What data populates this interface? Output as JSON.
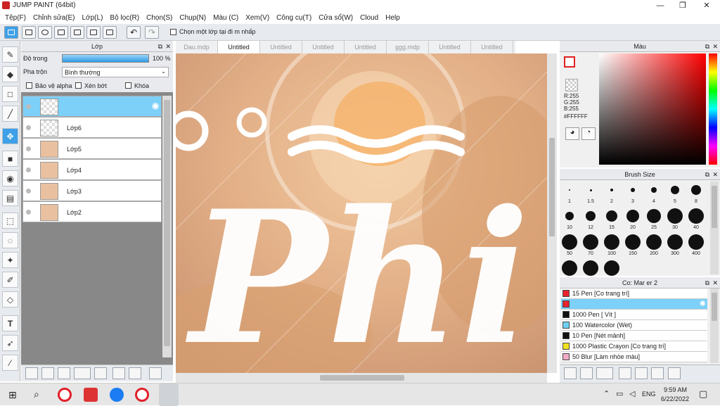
{
  "app": {
    "title": "JUMP PAINT (64bit)"
  },
  "menu": [
    "Tệp(F)",
    "Chỉnh sửa(E)",
    "Lớp(L)",
    "Bộ lọc(R)",
    "Chọn(S)",
    "Chụp(N)",
    "Màu (C)",
    "Xem(V)",
    "Công cụ(T)",
    "Cửa sổ(W)",
    "Cloud",
    "Help"
  ],
  "toolbar": {
    "option_label": "Chọn một lớp tại đi m nhấp"
  },
  "layers": {
    "title": "Lớp",
    "opacity_label": "Độ trong",
    "opacity_value": "100 %",
    "opacity": 1.0,
    "blend_label": "Pha trộn",
    "blend_value": "Bình thường",
    "protect_alpha": "Bảo vệ alpha",
    "clip": "Xén bớt",
    "lock": "Khóa",
    "items": [
      {
        "name": ""
      },
      {
        "name": "Lớp6"
      },
      {
        "name": "Lớp5"
      },
      {
        "name": "Lớp4"
      },
      {
        "name": "Lớp3"
      },
      {
        "name": "Lớp2"
      }
    ]
  },
  "tabs": [
    "Dau.mdp",
    "Untitled",
    "Untitled",
    "Untitled",
    "Untitled",
    "ggg.mdp",
    "Untitled",
    "Untitled"
  ],
  "canvas": {
    "text": "Phi"
  },
  "color": {
    "title": "Màu",
    "r": "R:255",
    "g": "G:255",
    "b": "B:255",
    "hex": "#FFFFFF"
  },
  "brush": {
    "title": "Brush Size",
    "sizes": [
      "1",
      "1.5",
      "2",
      "3",
      "4",
      "5",
      "8",
      "10",
      "12",
      "15",
      "20",
      "25",
      "30",
      "40",
      "50",
      "70",
      "100",
      "150",
      "200",
      "300",
      "400",
      "",
      "",
      ""
    ]
  },
  "marker": {
    "title": "Co: Mar er 2",
    "items": [
      {
        "label": "15     Pen [Co trang trí]",
        "color": "#e8232e"
      },
      {
        "label": "",
        "color": "#e8232e"
      },
      {
        "label": "1000 Pen [ Vít ]",
        "color": "#111111"
      },
      {
        "label": "100   Watercolor (Wet)",
        "color": "#6fd1f0"
      },
      {
        "label": "10     Pen [Nét mảnh]",
        "color": "#111111"
      },
      {
        "label": "1000 Plastic Crayon [Co trang trí]",
        "color": "#f0e020"
      },
      {
        "label": "50     Blur [Làm nhòe màu]",
        "color": "#f2a9c8"
      }
    ]
  },
  "taskbar": {
    "lang": "ENG",
    "time": "9:59 AM",
    "date": "6/22/2022"
  }
}
